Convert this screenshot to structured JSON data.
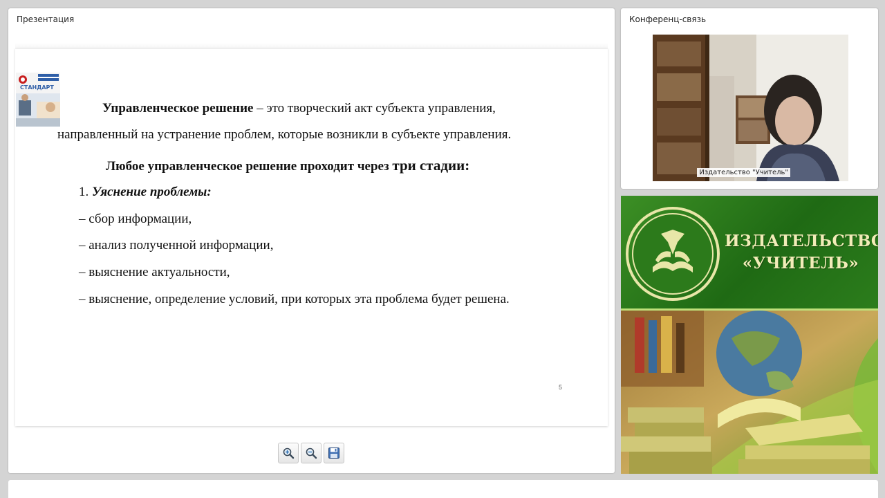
{
  "presentation": {
    "title": "Презентация",
    "slide": {
      "logo_text": "СТАНДАРТ",
      "para1_bold": "Управленческое решение",
      "para1_rest": " – это творческий акт субъекта управления,",
      "para1_line2": "направленный на устранение проблем, которые возникли в субъекте управления.",
      "heading_part1": "Любое управленческое решение проходит через ",
      "heading_part2": "три стадии:",
      "list_number": "1.",
      "list_title": "Уяснение проблемы:",
      "items": [
        "– сбор информации,",
        "– анализ полученной информации,",
        "– выяснение актуальности,",
        "– выяснение, определение условий, при которых эта проблема будет решена."
      ],
      "page_number": "5"
    },
    "toolbar": {
      "zoom_in": "zoom-in-icon",
      "zoom_out": "zoom-out-icon",
      "save": "save-icon"
    }
  },
  "conference": {
    "title": "Конференц-связь",
    "participant_label": "Издательство \"Учитель\""
  },
  "banner": {
    "line1": "ИЗДАТЕЛЬСТВО",
    "line2": "«УЧИТЕЛЬ»"
  },
  "colors": {
    "banner_green": "#2e7b1d",
    "banner_text": "#f2ecb8"
  }
}
